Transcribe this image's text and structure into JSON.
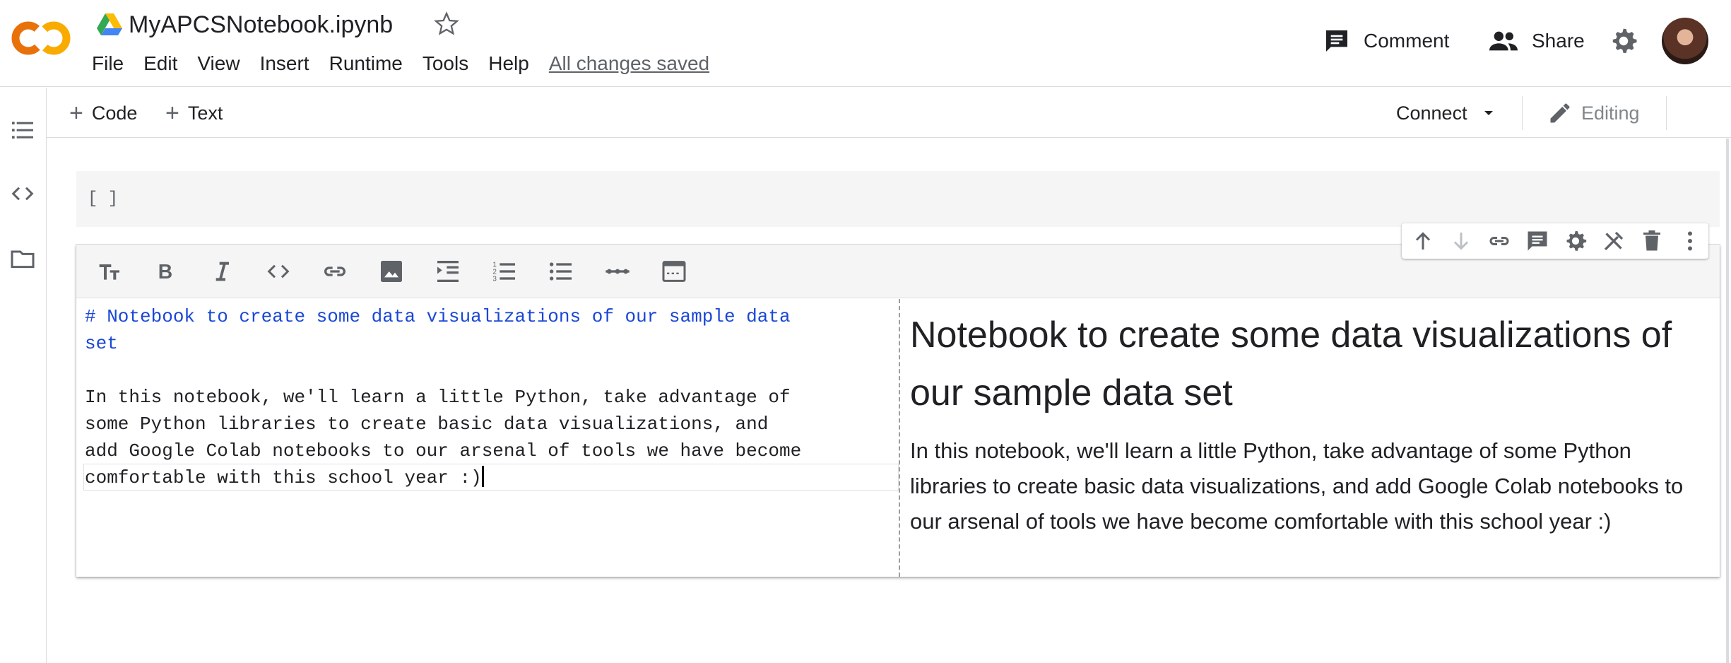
{
  "app": {
    "notebook_title": "MyAPCSNotebook.ipynb",
    "logo_text": "CO",
    "save_status": "All changes saved"
  },
  "menu": [
    "File",
    "Edit",
    "View",
    "Insert",
    "Runtime",
    "Tools",
    "Help"
  ],
  "header_actions": {
    "comment_label": "Comment",
    "share_label": "Share"
  },
  "toolbar": {
    "add_code_label": "Code",
    "add_text_label": "Text",
    "connect_label": "Connect",
    "editing_label": "Editing"
  },
  "code_cell": {
    "execution_bracket": "[ ]"
  },
  "text_cell": {
    "source_heading": "# Notebook to create some data visualizations of our sample data\nset",
    "source_body_before_caret": "In this notebook, we'll learn a little Python, take advantage of\nsome Python libraries to create basic data visualizations, and\nadd Google Colab notebooks to our arsenal of tools we have become\ncomfortable with this school year :)",
    "preview_heading": "Notebook to create some data visualizations of our sample data set",
    "preview_body": "In this notebook, we'll learn a little Python, take advantage of some Python libraries to create basic data visualizations, and add Google Colab notebooks to our arsenal of tools we have become comfortable with this school year :)"
  },
  "icons": {
    "left_rail": [
      "table-of-contents-icon",
      "code-snippets-icon",
      "files-icon"
    ],
    "format_bar": [
      "text-size-icon",
      "bold-icon",
      "italic-icon",
      "code-icon",
      "link-icon",
      "image-icon",
      "indent-icon",
      "numbered-list-icon",
      "bulleted-list-icon",
      "horizontal-rule-icon",
      "toggle-preview-icon"
    ],
    "cell_actions": [
      "move-up-icon",
      "move-down-icon",
      "link-to-cell-icon",
      "add-comment-icon",
      "cell-settings-icon",
      "close-editor-icon",
      "delete-cell-icon",
      "more-icon"
    ]
  },
  "colors": {
    "logo_orange": "#F9AB00",
    "logo_dark_orange": "#E8710A",
    "markdown_heading_blue": "#1A47D6",
    "icon_gray": "#5F6368"
  }
}
